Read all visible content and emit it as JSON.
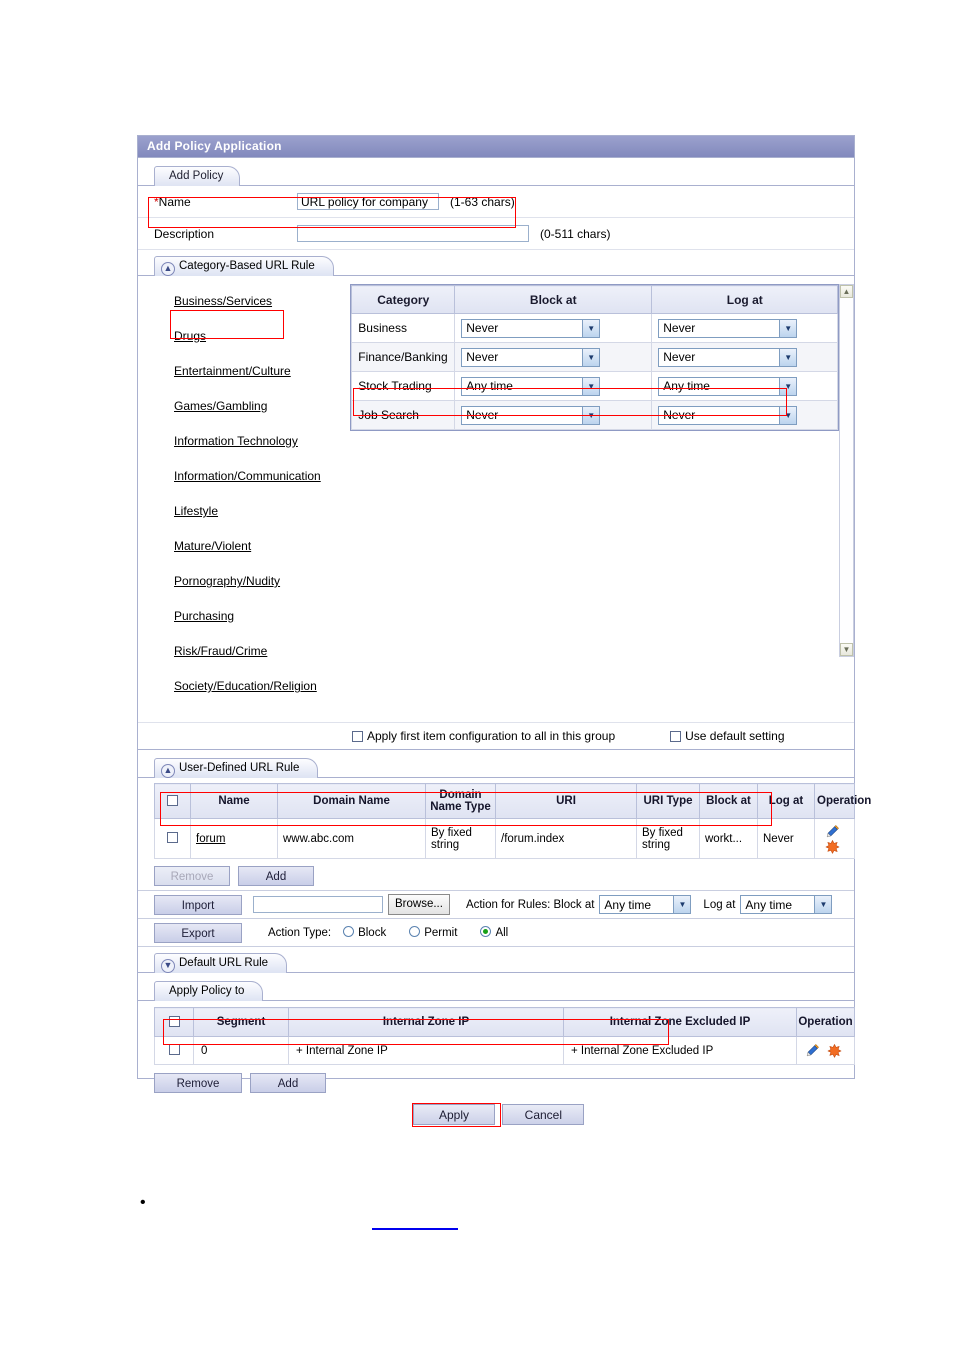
{
  "window": {
    "title": "Add Policy Application"
  },
  "tabs": {
    "add_policy": "Add Policy"
  },
  "form": {
    "name_label": "Name",
    "name_required_mark": "*",
    "name_value": "URL policy for company",
    "name_hint": "(1-63  chars)",
    "description_label": "Description",
    "description_value": "",
    "description_placeholder": "",
    "description_hint": "(0-511  chars)"
  },
  "sections": {
    "category_based": {
      "label": "Category-Based URL Rule",
      "chevron": "up-chevron-icon"
    },
    "user_defined": {
      "label": "User-Defined URL Rule",
      "chevron": "up-chevron-icon"
    },
    "default_url": {
      "label": "Default URL Rule",
      "chevron": "down-chevron-icon"
    },
    "apply_policy_to": {
      "label": "Apply Policy to"
    }
  },
  "categories": {
    "selected": "Business/Services",
    "items": [
      "Business/Services",
      "Drugs",
      "Entertainment/Culture",
      "Games/Gambling",
      "Information Technology",
      "Information/Communication",
      "Lifestyle",
      "Mature/Violent",
      "Pornography/Nudity",
      "Purchasing",
      "Risk/Fraud/Crime",
      "Society/Education/Religion"
    ]
  },
  "category_table": {
    "headers": [
      "Category",
      "Block at",
      "Log at"
    ],
    "rows": [
      {
        "category": "Business",
        "block_at": "Never",
        "log_at": "Never",
        "highlighted": false
      },
      {
        "category": "Finance/Banking",
        "block_at": "Never",
        "log_at": "Never",
        "highlighted": false
      },
      {
        "category": "Stock Trading",
        "block_at": "Any time",
        "log_at": "Any time",
        "highlighted": true
      },
      {
        "category": "Job Search",
        "block_at": "Never",
        "log_at": "Never",
        "highlighted": false
      }
    ]
  },
  "category_options": {
    "apply_first_item": "Apply first item configuration to all in this group",
    "use_default_setting": "Use default setting"
  },
  "user_defined_table": {
    "headers": [
      "Name",
      "Domain Name",
      "Domain Name Type",
      "URI",
      "URI Type",
      "Block at",
      "Log at",
      "Operation"
    ],
    "rows": [
      {
        "name": "forum",
        "domain_name": "www.abc.com",
        "domain_name_type": "By fixed string",
        "uri": "/forum.index",
        "uri_type": "By fixed string",
        "block_at": "workt...",
        "log_at": "Never"
      }
    ],
    "buttons": {
      "remove": "Remove",
      "add": "Add"
    }
  },
  "import_export": {
    "import_label": "Import",
    "export_label": "Export",
    "file_value": "",
    "browse_label": "Browse...",
    "action_for_rules_label": "Action for Rules: Block at",
    "block_at_value": "Any time",
    "log_at_label": "Log at",
    "log_at_value": "Any time",
    "action_type_label": "Action Type:",
    "action_types": [
      {
        "label": "Block",
        "selected": false
      },
      {
        "label": "Permit",
        "selected": false
      },
      {
        "label": "All",
        "selected": true
      }
    ]
  },
  "apply_policy_table": {
    "headers": [
      "Segment",
      "Internal Zone IP",
      "Internal Zone Excluded IP",
      "Operation"
    ],
    "rows": [
      {
        "segment": "0",
        "internal_zone_ip": "+ Internal Zone IP",
        "internal_zone_excluded_ip": "+ Internal Zone Excluded IP"
      }
    ],
    "buttons": {
      "remove": "Remove",
      "add": "Add"
    }
  },
  "footer": {
    "apply": "Apply",
    "cancel": "Cancel"
  },
  "colors": {
    "titlebar": "#8289bd",
    "highlight_border": "#ff0000",
    "header_bg": "#dfe3f2",
    "link_blue": "#0000ee"
  }
}
